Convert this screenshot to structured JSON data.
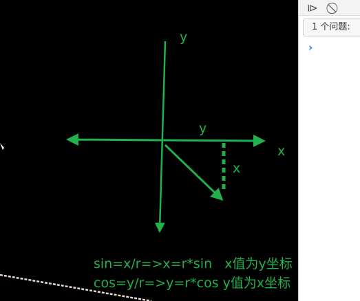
{
  "drawing": {
    "color": "#22b14c",
    "labels": {
      "y_axis": "y",
      "y_proj": "y",
      "x_axis": "x",
      "x_proj": "x"
    },
    "notes": [
      "sin=x/r=>x=r*sin   x值为y坐标",
      "cos=y/r=>y=r*cos y值为x坐标"
    ]
  },
  "devtools": {
    "issues_label": "1 个问题:",
    "icons": [
      "play-panel-icon",
      "block-icon"
    ],
    "prompt": "›"
  }
}
